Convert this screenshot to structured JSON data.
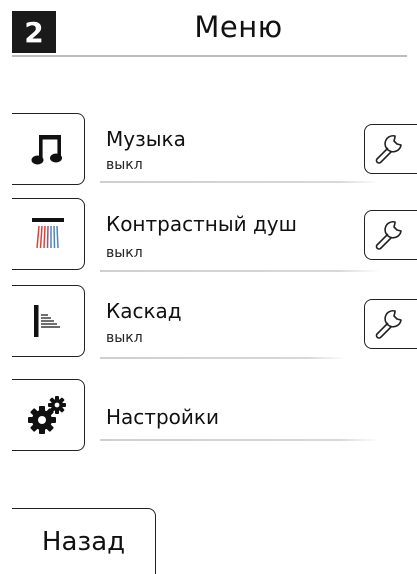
{
  "header": {
    "page_number": "2",
    "title": "Меню"
  },
  "menu": {
    "items": [
      {
        "label": "Музыка",
        "status": "выкл",
        "icon": "music-note-icon"
      },
      {
        "label": "Контрастный душ",
        "status": "выкл",
        "icon": "contrast-shower-icon"
      },
      {
        "label": "Каскад",
        "status": "выкл",
        "icon": "cascade-icon"
      },
      {
        "label": "Настройки",
        "icon": "gears-icon"
      }
    ],
    "settings_icon": "wrench-icon"
  },
  "footer": {
    "back_label": "Назад"
  },
  "colors": {
    "shower_hot": "#d9443a",
    "shower_cold": "#4a86c6"
  }
}
